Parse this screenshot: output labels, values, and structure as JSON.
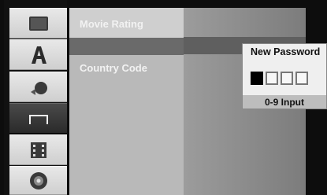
{
  "sidebar": {
    "items": [
      {
        "icon": "tv-screen-icon"
      },
      {
        "icon": "language-a-icon"
      },
      {
        "icon": "audio-speaker-icon"
      },
      {
        "icon": "lock-icon",
        "selected": true
      },
      {
        "icon": "film-strip-icon"
      },
      {
        "icon": "disc-icon"
      }
    ]
  },
  "menu": {
    "items": [
      {
        "label": "Movie Rating"
      },
      {
        "label": ""
      },
      {
        "label": "Country Code"
      }
    ]
  },
  "popup": {
    "title": "New Password",
    "hint": "0-9 Input",
    "boxes": 4,
    "active_box": 1
  },
  "colors": {
    "menu_text": "#f2f2f2",
    "highlight": "#cfcfcf",
    "selected_row": "#6a6a6a"
  }
}
